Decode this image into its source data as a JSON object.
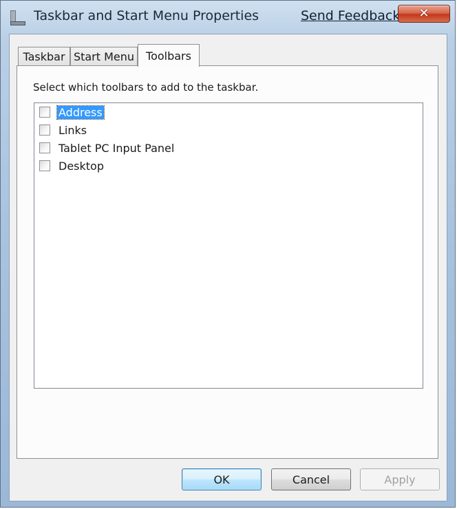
{
  "window": {
    "title": "Taskbar and Start Menu Properties",
    "send_feedback": "Send Feedback",
    "close_glyph": "✕",
    "icon": "taskbar-properties-icon"
  },
  "tabs": [
    {
      "label": "Taskbar",
      "active": false
    },
    {
      "label": "Start Menu",
      "active": false
    },
    {
      "label": "Toolbars",
      "active": true
    }
  ],
  "toolbars_tab": {
    "instruction": "Select which toolbars to add to the taskbar.",
    "items": [
      {
        "label": "Address",
        "checked": false,
        "selected": true
      },
      {
        "label": "Links",
        "checked": false,
        "selected": false
      },
      {
        "label": "Tablet PC Input Panel",
        "checked": false,
        "selected": false
      },
      {
        "label": "Desktop",
        "checked": false,
        "selected": false
      }
    ]
  },
  "buttons": {
    "ok": "OK",
    "cancel": "Cancel",
    "apply": "Apply"
  },
  "colors": {
    "selection": "#3399ff",
    "close_button": "#c2391c",
    "frame": "#a7c2de"
  }
}
